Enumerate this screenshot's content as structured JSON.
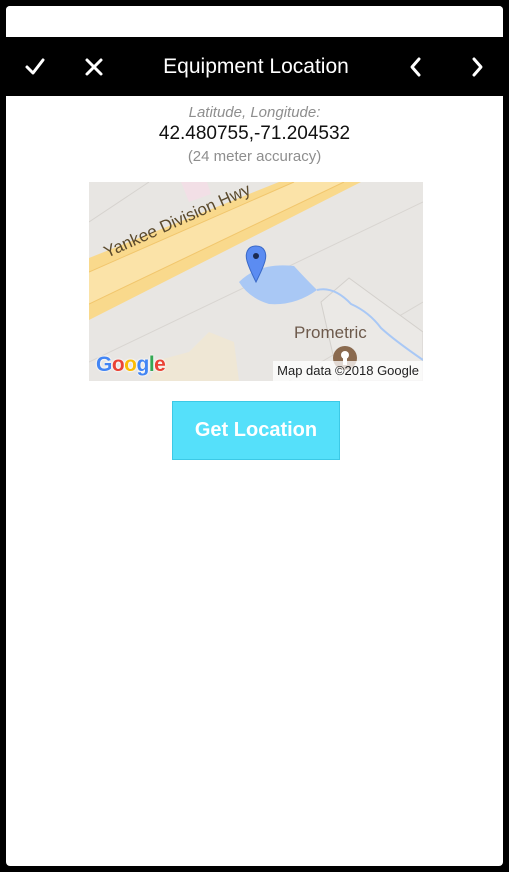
{
  "header": {
    "title": "Equipment Location",
    "confirm_icon": "checkmark-icon",
    "cancel_icon": "close-icon",
    "prev_icon": "chevron-left-icon",
    "next_icon": "chevron-right-icon",
    "background": "#000000"
  },
  "location": {
    "label": "Latitude, Longitude:",
    "value": "42.480755,-71.204532",
    "accuracy": "(24 meter accuracy)"
  },
  "map": {
    "road_label": "Yankee Division Hwy",
    "place_label": "Prometric",
    "attribution": "Map data ©2018 Google",
    "logo_letters": [
      "G",
      "o",
      "o",
      "g",
      "l",
      "e"
    ],
    "logo_colors": [
      "#4285F4",
      "#EA4335",
      "#FBBC05",
      "#4285F4",
      "#34A853",
      "#EA4335"
    ],
    "pin_icon": "map-pin-icon",
    "place_icon": "place-marker-icon"
  },
  "actions": {
    "get_location_label": "Get Location",
    "accent": "#55e0fa"
  }
}
